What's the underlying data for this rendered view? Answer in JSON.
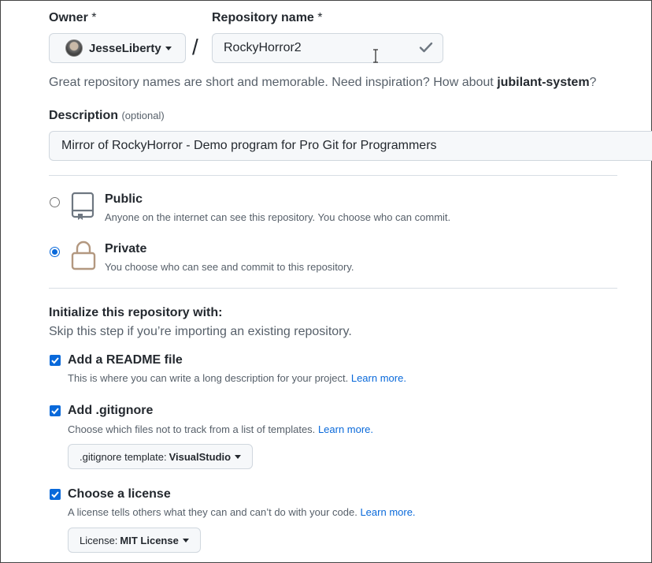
{
  "owner": {
    "label": "Owner",
    "required_mark": "*",
    "value": "JesseLiberty"
  },
  "separator": "/",
  "repo": {
    "label": "Repository name",
    "required_mark": "*",
    "value": "RockyHorror2"
  },
  "hint": {
    "text": "Great repository names are short and memorable. Need inspiration? How about",
    "suggestion": "jubilant-system",
    "end": "?"
  },
  "description": {
    "label": "Description",
    "optional": "(optional)",
    "value": "Mirror of RockyHorror - Demo program for Pro Git for Programmers"
  },
  "visibility": {
    "public": {
      "title": "Public",
      "subtitle": "Anyone on the internet can see this repository. You choose who can commit.",
      "selected": false
    },
    "private": {
      "title": "Private",
      "subtitle": "You choose who can see and commit to this repository.",
      "selected": true
    }
  },
  "init": {
    "title": "Initialize this repository with:",
    "subtitle": "Skip this step if you’re importing an existing repository.",
    "readme": {
      "title": "Add a README file",
      "subtitle": "This is where you can write a long description for your project.",
      "link": "Learn more.",
      "checked": true
    },
    "gitignore": {
      "title": "Add .gitignore",
      "subtitle": "Choose which files not to track from a list of templates.",
      "link": "Learn more.",
      "checked": true,
      "select_prefix": ".gitignore template:",
      "select_value": "VisualStudio"
    },
    "license": {
      "title": "Choose a license",
      "subtitle": "A license tells others what they can and can’t do with your code.",
      "link": "Learn more.",
      "checked": true,
      "select_prefix": "License:",
      "select_value": "MIT License"
    }
  },
  "icons": {
    "public": "repo-book-icon",
    "private": "lock-icon",
    "valid": "check-icon",
    "cursor": "text-cursor-icon"
  },
  "colors": {
    "accent": "#0969da",
    "muted": "#57606a",
    "lock": "#b39880"
  }
}
